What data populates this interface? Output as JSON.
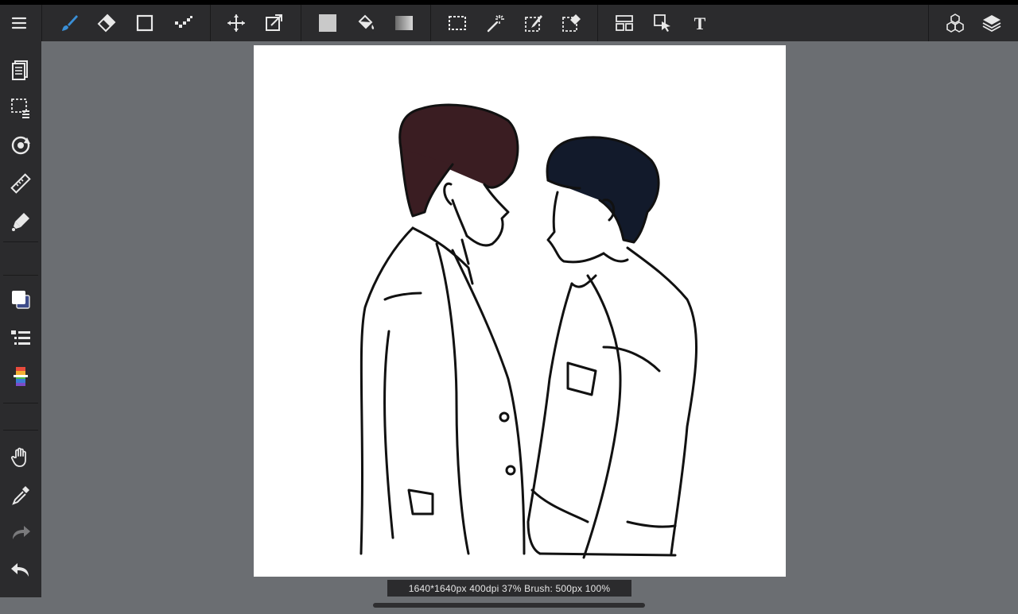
{
  "app": {
    "status_text": "1640*1640px 400dpi 37% Brush: 500px 100%"
  },
  "colors": {
    "toolbar_bg": "#2b2b2d",
    "workspace_bg": "#6b6e72",
    "active_tool": "#3a8fd6",
    "icon": "#e8e8e8"
  },
  "toolbar": {
    "tools": [
      {
        "name": "menu-icon"
      },
      {
        "name": "brush-icon",
        "active": true
      },
      {
        "name": "eraser-icon"
      },
      {
        "name": "smudge-icon"
      },
      {
        "name": "blur-icon"
      },
      {
        "name": "move-icon"
      },
      {
        "name": "transform-icon"
      },
      {
        "name": "fill-color-icon"
      },
      {
        "name": "bucket-icon"
      },
      {
        "name": "gradient-icon"
      },
      {
        "name": "select-rect-icon"
      },
      {
        "name": "magic-wand-icon"
      },
      {
        "name": "select-pen-icon"
      },
      {
        "name": "select-eraser-icon"
      },
      {
        "name": "frame-divider-icon"
      },
      {
        "name": "operation-icon"
      },
      {
        "name": "text-icon",
        "glyph": "T"
      },
      {
        "name": "3d-material-icon"
      },
      {
        "name": "layers-icon"
      }
    ]
  },
  "sidebar": {
    "tools": [
      {
        "name": "page-manager-icon"
      },
      {
        "name": "selection-icon"
      },
      {
        "name": "rotate-icon"
      },
      {
        "name": "ruler-icon"
      },
      {
        "name": "snap-icon"
      },
      {
        "name": "color-swatch-icon"
      },
      {
        "name": "brush-list-icon"
      },
      {
        "name": "color-palette-icon"
      },
      {
        "name": "hand-icon"
      },
      {
        "name": "eyedropper-icon"
      },
      {
        "name": "redo-icon"
      },
      {
        "name": "undo-icon"
      }
    ]
  }
}
